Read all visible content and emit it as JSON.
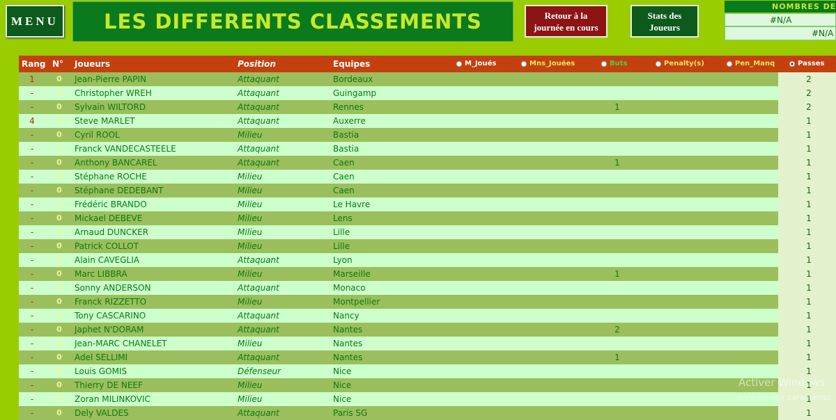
{
  "toolbar": {
    "menu_label": "MENU",
    "title": "LES DIFFERENTS CLASSEMENTS",
    "retour_label": "Retour à la journée en cours",
    "stats_label": "Stats des Joueurs"
  },
  "nombres": {
    "header": "NOMBRES DE",
    "value1": "#N/A",
    "value2": "#N/A"
  },
  "columns": {
    "rang": "Rang",
    "num": "N°",
    "joueurs": "Joueurs",
    "position": "Position",
    "equipes": "Equipes"
  },
  "sort_options": [
    {
      "label": "M_Joués",
      "selected": false,
      "color": "#ffffff"
    },
    {
      "label": "Mns_Jouées",
      "selected": false,
      "color": "#e8e860"
    },
    {
      "label": "Buts",
      "selected": false,
      "color": "#50d040"
    },
    {
      "label": "Penalty(s)",
      "selected": false,
      "color": "#e8e860"
    },
    {
      "label": "Pen_Manq",
      "selected": false,
      "color": "#e8e860"
    },
    {
      "label": "Passes",
      "selected": true,
      "color": "#ffffff"
    }
  ],
  "rows": [
    {
      "rang": "1",
      "num": "0",
      "joueur": "Jean-Pierre PAPIN",
      "position": "Attaquant",
      "equipe": "Bordeaux",
      "buts": "",
      "passes": "2"
    },
    {
      "rang": "-",
      "num": "0",
      "joueur": "Christopher WREH",
      "position": "Attaquant",
      "equipe": "Guingamp",
      "buts": "",
      "passes": "2"
    },
    {
      "rang": "-",
      "num": "0",
      "joueur": "Sylvain WILTORD",
      "position": "Attaquant",
      "equipe": "Rennes",
      "buts": "1",
      "passes": "2"
    },
    {
      "rang": "4",
      "num": "0",
      "joueur": "Steve MARLET",
      "position": "Attaquant",
      "equipe": "Auxerre",
      "buts": "",
      "passes": "1"
    },
    {
      "rang": "-",
      "num": "0",
      "joueur": "Cyril ROOL",
      "position": "Milieu",
      "equipe": "Bastia",
      "buts": "",
      "passes": "1"
    },
    {
      "rang": "-",
      "num": "0",
      "joueur": "Franck VANDECASTEELE",
      "position": "Attaquant",
      "equipe": "Bastia",
      "buts": "",
      "passes": "1"
    },
    {
      "rang": "-",
      "num": "0",
      "joueur": "Anthony BANCAREL",
      "position": "Attaquant",
      "equipe": "Caen",
      "buts": "1",
      "passes": "1"
    },
    {
      "rang": "-",
      "num": "0",
      "joueur": "Stéphane ROCHE",
      "position": "Milieu",
      "equipe": "Caen",
      "buts": "",
      "passes": "1"
    },
    {
      "rang": "-",
      "num": "0",
      "joueur": "Stéphane DEDEBANT",
      "position": "Milieu",
      "equipe": "Caen",
      "buts": "",
      "passes": "1"
    },
    {
      "rang": "-",
      "num": "0",
      "joueur": "Frédéric BRANDO",
      "position": "Milieu",
      "equipe": "Le Havre",
      "buts": "",
      "passes": "1"
    },
    {
      "rang": "-",
      "num": "0",
      "joueur": "Mickael DEBEVE",
      "position": "Milieu",
      "equipe": "Lens",
      "buts": "",
      "passes": "1"
    },
    {
      "rang": "-",
      "num": "0",
      "joueur": "Arnaud DUNCKER",
      "position": "Milieu",
      "equipe": "Lille",
      "buts": "",
      "passes": "1"
    },
    {
      "rang": "-",
      "num": "0",
      "joueur": "Patrick COLLOT",
      "position": "Milieu",
      "equipe": "Lille",
      "buts": "",
      "passes": "1"
    },
    {
      "rang": "-",
      "num": "0",
      "joueur": "Alain CAVEGLIA",
      "position": "Attaquant",
      "equipe": "Lyon",
      "buts": "",
      "passes": "1"
    },
    {
      "rang": "-",
      "num": "0",
      "joueur": "Marc LIBBRA",
      "position": "Milieu",
      "equipe": "Marseille",
      "buts": "1",
      "passes": "1"
    },
    {
      "rang": "-",
      "num": "0",
      "joueur": "Sonny ANDERSON",
      "position": "Attaquant",
      "equipe": "Monaco",
      "buts": "",
      "passes": "1"
    },
    {
      "rang": "-",
      "num": "0",
      "joueur": "Franck RIZZETTO",
      "position": "Milieu",
      "equipe": "Montpellier",
      "buts": "",
      "passes": "1"
    },
    {
      "rang": "-",
      "num": "0",
      "joueur": "Tony CASCARINO",
      "position": "Attaquant",
      "equipe": "Nancy",
      "buts": "",
      "passes": "1"
    },
    {
      "rang": "-",
      "num": "0",
      "joueur": "Japhet N'DORAM",
      "position": "Attaquant",
      "equipe": "Nantes",
      "buts": "2",
      "passes": "1"
    },
    {
      "rang": "-",
      "num": "0",
      "joueur": "Jean-MARC CHANELET",
      "position": "Milieu",
      "equipe": "Nantes",
      "buts": "",
      "passes": "1"
    },
    {
      "rang": "-",
      "num": "0",
      "joueur": "Adel SELLIMI",
      "position": "Attaquant",
      "equipe": "Nantes",
      "buts": "1",
      "passes": "1"
    },
    {
      "rang": "-",
      "num": "0",
      "joueur": "Louis GOMIS",
      "position": "Défenseur",
      "equipe": "Nice",
      "buts": "",
      "passes": "1"
    },
    {
      "rang": "-",
      "num": "0",
      "joueur": "Thierry DE NEEF",
      "position": "Milieu",
      "equipe": "Nice",
      "buts": "",
      "passes": "1"
    },
    {
      "rang": "-",
      "num": "0",
      "joueur": "Zoran MILINKOVIC",
      "position": "Milieu",
      "equipe": "Nice",
      "buts": "",
      "passes": "1"
    },
    {
      "rang": "-",
      "num": "0",
      "joueur": "Dely VALDES",
      "position": "Attaquant",
      "equipe": "Paris SG",
      "buts": "",
      "passes": "1"
    }
  ],
  "watermark": {
    "line1": "Activer Windows",
    "line2": "Accédez aux paramètres"
  }
}
